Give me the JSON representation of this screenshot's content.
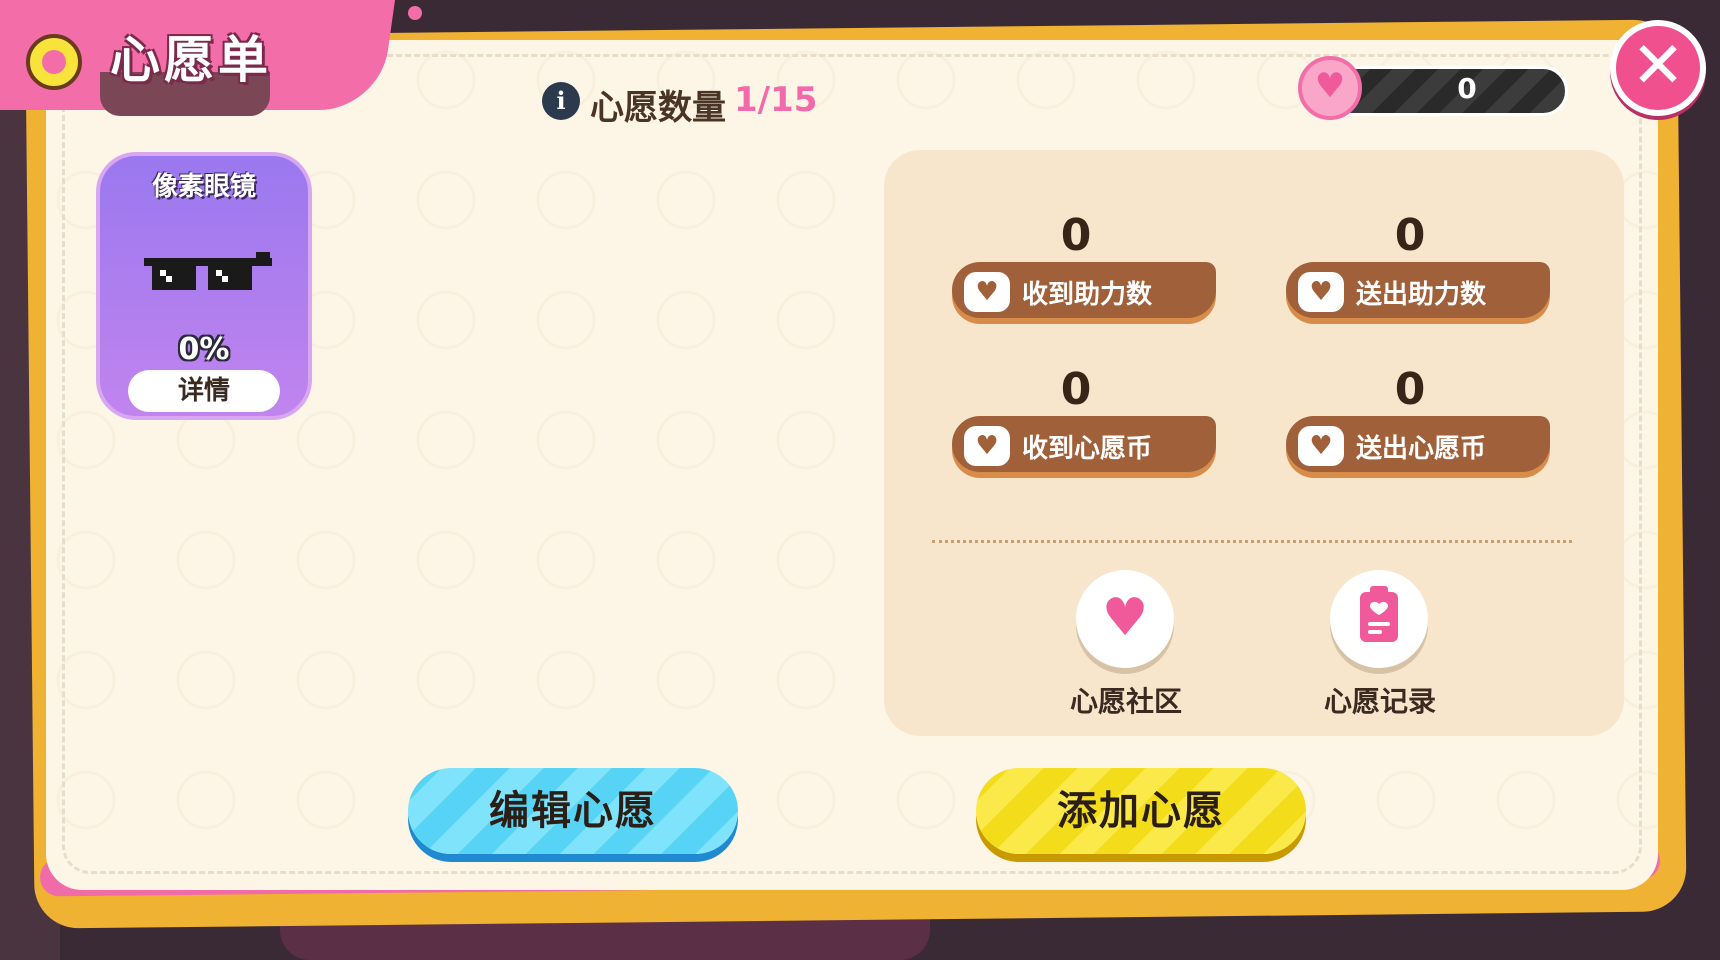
{
  "header": {
    "title": "心愿单",
    "title_icon": "wishlist-badge-icon",
    "wish_count_label": "心愿数量",
    "wish_count_value": "1/15",
    "currency_value": "0",
    "currency_icon": "wish-coin-icon",
    "close_icon": "close-icon"
  },
  "wish_items": [
    {
      "name": "像素眼镜",
      "icon": "pixel-glasses-icon",
      "progress": "0%",
      "detail_label": "详情"
    }
  ],
  "stats": {
    "received_help": {
      "value": "0",
      "label": "收到助力数",
      "icon": "received-help-icon"
    },
    "sent_help": {
      "value": "0",
      "label": "送出助力数",
      "icon": "sent-help-icon"
    },
    "received_coins": {
      "value": "0",
      "label": "收到心愿币",
      "icon": "heart-icon"
    },
    "sent_coins": {
      "value": "0",
      "label": "送出心愿币",
      "icon": "gift-heart-icon"
    }
  },
  "actions": {
    "community_label": "心愿社区",
    "community_icon": "heart-pin-icon",
    "records_label": "心愿记录",
    "records_icon": "clipboard-icon"
  },
  "buttons": {
    "edit_label": "编辑心愿",
    "add_label": "添加心愿"
  },
  "colors": {
    "accent_pink": "#f36ea8",
    "panel_bg": "#fdf6e6",
    "edit_button": "#56d3f5",
    "add_button": "#f3dc1a",
    "stat_pill": "#a0603a"
  }
}
